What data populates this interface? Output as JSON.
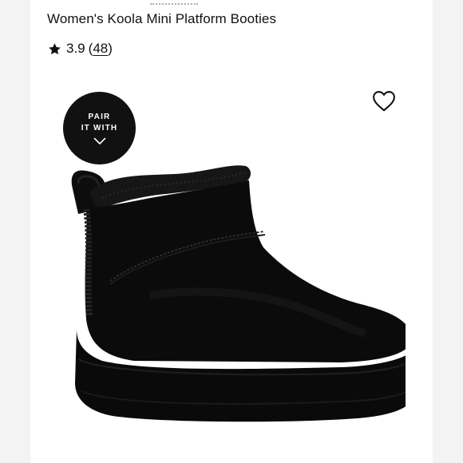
{
  "product": {
    "title": "Women's Koola Mini Platform Booties",
    "rating_value": "3.9",
    "review_count": "48",
    "image_alt": "Black suede mini platform bootie with shearling trim"
  },
  "pair_with": {
    "line1": "PAIR",
    "line2": "IT WITH"
  },
  "icons": {
    "rating": "star-icon",
    "favorite": "heart-icon",
    "expand": "chevron-down-icon"
  },
  "colors": {
    "badge_bg": "#111111",
    "page_bg": "#f3f3f3",
    "card_bg": "#ffffff"
  }
}
